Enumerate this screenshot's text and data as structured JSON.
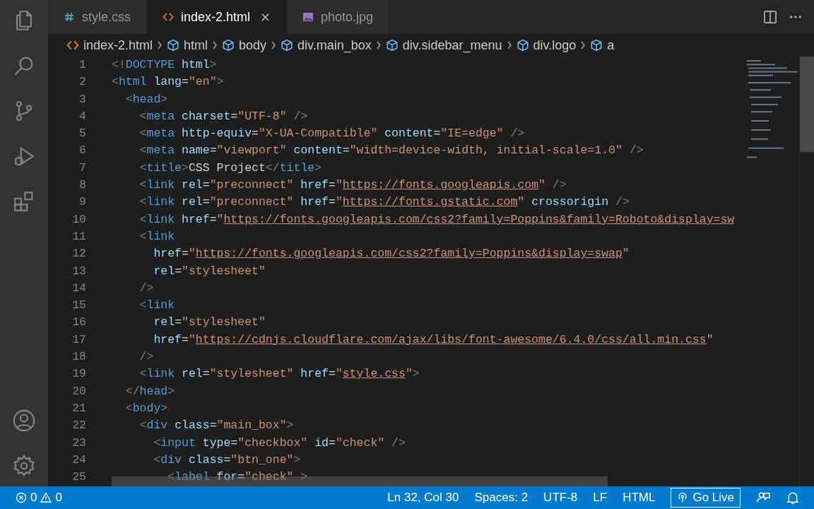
{
  "tabs": [
    {
      "label": "style.css",
      "kind": "css",
      "selected": false
    },
    {
      "label": "index-2.html",
      "kind": "html",
      "selected": true
    },
    {
      "label": "photo.jpg",
      "kind": "image",
      "selected": false
    }
  ],
  "breadcrumbs": [
    {
      "label": "index-2.html",
      "kind": "file"
    },
    {
      "label": "html",
      "kind": "element"
    },
    {
      "label": "body",
      "kind": "element"
    },
    {
      "label": "div.main_box",
      "kind": "element"
    },
    {
      "label": "div.sidebar_menu",
      "kind": "element"
    },
    {
      "label": "div.logo",
      "kind": "element"
    },
    {
      "label": "a",
      "kind": "element"
    }
  ],
  "editor": {
    "lines": [
      {
        "n": "1",
        "tokens": [
          {
            "kind": "punct",
            "text": "<!"
          },
          {
            "kind": "tag",
            "text": "DOCTYPE"
          },
          {
            "kind": "attr",
            "text": " html"
          },
          {
            "kind": "punct",
            "text": ">"
          }
        ]
      },
      {
        "n": "2",
        "tokens": [
          {
            "kind": "punct",
            "text": "<"
          },
          {
            "kind": "tag",
            "text": "html"
          },
          {
            "kind": "attr",
            "text": " lang"
          },
          {
            "kind": "plain",
            "text": "="
          },
          {
            "kind": "string",
            "text": "\"en\""
          },
          {
            "kind": "punct",
            "text": ">"
          }
        ]
      },
      {
        "n": "3",
        "tokens": [
          {
            "kind": "punct",
            "text": "  <"
          },
          {
            "kind": "tag",
            "text": "head"
          },
          {
            "kind": "punct",
            "text": ">"
          }
        ]
      },
      {
        "n": "4",
        "tokens": [
          {
            "kind": "punct",
            "text": "    <"
          },
          {
            "kind": "tag",
            "text": "meta"
          },
          {
            "kind": "attr",
            "text": " charset"
          },
          {
            "kind": "plain",
            "text": "="
          },
          {
            "kind": "string",
            "text": "\"UTF-8\""
          },
          {
            "kind": "punct",
            "text": " />"
          }
        ]
      },
      {
        "n": "5",
        "tokens": [
          {
            "kind": "punct",
            "text": "    <"
          },
          {
            "kind": "tag",
            "text": "meta"
          },
          {
            "kind": "attr",
            "text": " http-equiv"
          },
          {
            "kind": "plain",
            "text": "="
          },
          {
            "kind": "string",
            "text": "\"X-UA-Compatible\""
          },
          {
            "kind": "attr",
            "text": " content"
          },
          {
            "kind": "plain",
            "text": "="
          },
          {
            "kind": "string",
            "text": "\"IE=edge\""
          },
          {
            "kind": "punct",
            "text": " />"
          }
        ]
      },
      {
        "n": "6",
        "tokens": [
          {
            "kind": "punct",
            "text": "    <"
          },
          {
            "kind": "tag",
            "text": "meta"
          },
          {
            "kind": "attr",
            "text": " name"
          },
          {
            "kind": "plain",
            "text": "="
          },
          {
            "kind": "string",
            "text": "\"viewport\""
          },
          {
            "kind": "attr",
            "text": " content"
          },
          {
            "kind": "plain",
            "text": "="
          },
          {
            "kind": "string",
            "text": "\"width=device-width, initial-scale=1.0\""
          },
          {
            "kind": "punct",
            "text": " />"
          }
        ]
      },
      {
        "n": "7",
        "tokens": [
          {
            "kind": "punct",
            "text": "    <"
          },
          {
            "kind": "tag",
            "text": "title"
          },
          {
            "kind": "punct",
            "text": ">"
          },
          {
            "kind": "plain",
            "text": "CSS Project"
          },
          {
            "kind": "punct",
            "text": "</"
          },
          {
            "kind": "tag",
            "text": "title"
          },
          {
            "kind": "punct",
            "text": ">"
          }
        ]
      },
      {
        "n": "8",
        "tokens": [
          {
            "kind": "punct",
            "text": "    <"
          },
          {
            "kind": "tag",
            "text": "link"
          },
          {
            "kind": "attr",
            "text": " rel"
          },
          {
            "kind": "plain",
            "text": "="
          },
          {
            "kind": "string",
            "text": "\"preconnect\""
          },
          {
            "kind": "attr",
            "text": " href"
          },
          {
            "kind": "plain",
            "text": "="
          },
          {
            "kind": "string",
            "text": "\""
          },
          {
            "kind": "url",
            "text": "https://fonts.googleapis.com"
          },
          {
            "kind": "string",
            "text": "\""
          },
          {
            "kind": "punct",
            "text": " />"
          }
        ]
      },
      {
        "n": "9",
        "tokens": [
          {
            "kind": "punct",
            "text": "    <"
          },
          {
            "kind": "tag",
            "text": "link"
          },
          {
            "kind": "attr",
            "text": " rel"
          },
          {
            "kind": "plain",
            "text": "="
          },
          {
            "kind": "string",
            "text": "\"preconnect\""
          },
          {
            "kind": "attr",
            "text": " href"
          },
          {
            "kind": "plain",
            "text": "="
          },
          {
            "kind": "string",
            "text": "\""
          },
          {
            "kind": "url",
            "text": "https://fonts.gstatic.com"
          },
          {
            "kind": "string",
            "text": "\""
          },
          {
            "kind": "attr",
            "text": " crossorigin"
          },
          {
            "kind": "punct",
            "text": " />"
          }
        ]
      },
      {
        "n": "10",
        "tokens": [
          {
            "kind": "punct",
            "text": "    <"
          },
          {
            "kind": "tag",
            "text": "link"
          },
          {
            "kind": "attr",
            "text": " href"
          },
          {
            "kind": "plain",
            "text": "="
          },
          {
            "kind": "string",
            "text": "\""
          },
          {
            "kind": "url",
            "text": "https://fonts.googleapis.com/css2?family=Poppins&family=Roboto&display=sw"
          }
        ]
      },
      {
        "n": "11",
        "tokens": [
          {
            "kind": "punct",
            "text": "    <"
          },
          {
            "kind": "tag",
            "text": "link"
          }
        ]
      },
      {
        "n": "12",
        "tokens": [
          {
            "kind": "attr",
            "text": "      href"
          },
          {
            "kind": "plain",
            "text": "="
          },
          {
            "kind": "string",
            "text": "\""
          },
          {
            "kind": "url",
            "text": "https://fonts.googleapis.com/css2?family=Poppins&display=swap"
          },
          {
            "kind": "string",
            "text": "\""
          }
        ]
      },
      {
        "n": "13",
        "tokens": [
          {
            "kind": "attr",
            "text": "      rel"
          },
          {
            "kind": "plain",
            "text": "="
          },
          {
            "kind": "string",
            "text": "\"stylesheet\""
          }
        ]
      },
      {
        "n": "14",
        "tokens": [
          {
            "kind": "punct",
            "text": "    />"
          }
        ]
      },
      {
        "n": "15",
        "tokens": [
          {
            "kind": "punct",
            "text": "    <"
          },
          {
            "kind": "tag",
            "text": "link"
          }
        ]
      },
      {
        "n": "16",
        "tokens": [
          {
            "kind": "attr",
            "text": "      rel"
          },
          {
            "kind": "plain",
            "text": "="
          },
          {
            "kind": "string",
            "text": "\"stylesheet\""
          }
        ]
      },
      {
        "n": "17",
        "tokens": [
          {
            "kind": "attr",
            "text": "      href"
          },
          {
            "kind": "plain",
            "text": "="
          },
          {
            "kind": "string",
            "text": "\""
          },
          {
            "kind": "url",
            "text": "https://cdnjs.cloudflare.com/ajax/libs/font-awesome/6.4.0/css/all.min.css"
          },
          {
            "kind": "string",
            "text": "\""
          }
        ]
      },
      {
        "n": "18",
        "tokens": [
          {
            "kind": "punct",
            "text": "    />"
          }
        ]
      },
      {
        "n": "19",
        "tokens": [
          {
            "kind": "punct",
            "text": "    <"
          },
          {
            "kind": "tag",
            "text": "link"
          },
          {
            "kind": "attr",
            "text": " rel"
          },
          {
            "kind": "plain",
            "text": "="
          },
          {
            "kind": "string",
            "text": "\"stylesheet\""
          },
          {
            "kind": "attr",
            "text": " href"
          },
          {
            "kind": "plain",
            "text": "="
          },
          {
            "kind": "string",
            "text": "\""
          },
          {
            "kind": "url",
            "text": "style.css"
          },
          {
            "kind": "string",
            "text": "\""
          },
          {
            "kind": "punct",
            "text": ">"
          }
        ]
      },
      {
        "n": "20",
        "tokens": [
          {
            "kind": "punct",
            "text": "  </"
          },
          {
            "kind": "tag",
            "text": "head"
          },
          {
            "kind": "punct",
            "text": ">"
          }
        ]
      },
      {
        "n": "21",
        "tokens": [
          {
            "kind": "punct",
            "text": "  <"
          },
          {
            "kind": "tag",
            "text": "body"
          },
          {
            "kind": "punct",
            "text": ">"
          }
        ]
      },
      {
        "n": "22",
        "tokens": [
          {
            "kind": "punct",
            "text": "    <"
          },
          {
            "kind": "tag",
            "text": "div"
          },
          {
            "kind": "attr",
            "text": " class"
          },
          {
            "kind": "plain",
            "text": "="
          },
          {
            "kind": "string",
            "text": "\"main_box\""
          },
          {
            "kind": "punct",
            "text": ">"
          }
        ]
      },
      {
        "n": "23",
        "tokens": [
          {
            "kind": "punct",
            "text": "      <"
          },
          {
            "kind": "tag",
            "text": "input"
          },
          {
            "kind": "attr",
            "text": " type"
          },
          {
            "kind": "plain",
            "text": "="
          },
          {
            "kind": "string",
            "text": "\"checkbox\""
          },
          {
            "kind": "attr",
            "text": " id"
          },
          {
            "kind": "plain",
            "text": "="
          },
          {
            "kind": "string",
            "text": "\"check\""
          },
          {
            "kind": "punct",
            "text": " />"
          }
        ]
      },
      {
        "n": "24",
        "tokens": [
          {
            "kind": "punct",
            "text": "      <"
          },
          {
            "kind": "tag",
            "text": "div"
          },
          {
            "kind": "attr",
            "text": " class"
          },
          {
            "kind": "plain",
            "text": "="
          },
          {
            "kind": "string",
            "text": "\"btn_one\""
          },
          {
            "kind": "punct",
            "text": ">"
          }
        ]
      },
      {
        "n": "25",
        "tokens": [
          {
            "kind": "punct",
            "text": "        <"
          },
          {
            "kind": "tag",
            "text": "label"
          },
          {
            "kind": "attr",
            "text": " for"
          },
          {
            "kind": "plain",
            "text": "="
          },
          {
            "kind": "string",
            "text": "\"check\""
          },
          {
            "kind": "punct",
            "text": " >"
          }
        ]
      }
    ]
  },
  "status_bar": {
    "errors": "0",
    "warnings": "0",
    "items": [
      {
        "label": "Ln 32, Col 30",
        "kind": "text"
      },
      {
        "label": "Spaces: 2",
        "kind": "text"
      },
      {
        "label": "UTF-8",
        "kind": "text"
      },
      {
        "label": "LF",
        "kind": "text"
      },
      {
        "label": "HTML",
        "kind": "text"
      },
      {
        "label": "Go Live",
        "kind": "live"
      }
    ]
  }
}
